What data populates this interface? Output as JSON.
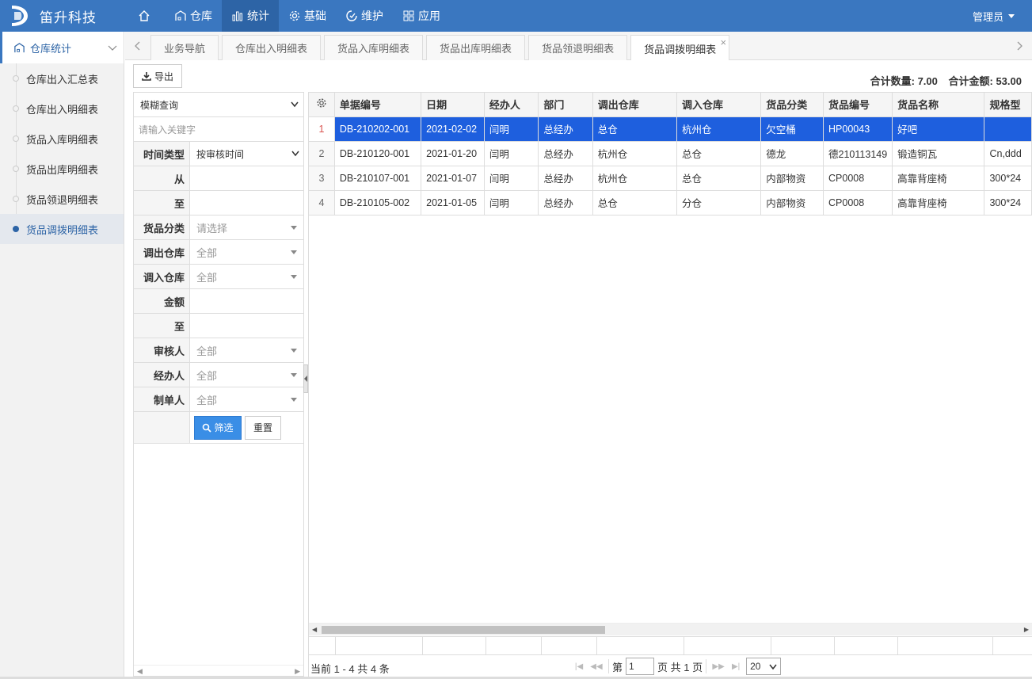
{
  "header": {
    "brand": "笛升科技",
    "nav": [
      {
        "key": "home",
        "label": "",
        "icon": "home-icon"
      },
      {
        "key": "warehouse",
        "label": "仓库",
        "icon": "warehouse-icon"
      },
      {
        "key": "stats",
        "label": "统计",
        "icon": "bar-chart-icon",
        "active": true
      },
      {
        "key": "basic",
        "label": "基础",
        "icon": "gear-icon"
      },
      {
        "key": "maintain",
        "label": "维护",
        "icon": "maintain-icon"
      },
      {
        "key": "apps",
        "label": "应用",
        "icon": "apps-icon"
      }
    ],
    "user": "管理员"
  },
  "sidebar": {
    "group": "仓库统计",
    "items": [
      {
        "label": "仓库出入汇总表"
      },
      {
        "label": "仓库出入明细表"
      },
      {
        "label": "货品入库明细表"
      },
      {
        "label": "货品出库明细表"
      },
      {
        "label": "货品领退明细表"
      },
      {
        "label": "货品调拨明细表",
        "active": true
      }
    ]
  },
  "tabs": [
    {
      "label": "业务导航"
    },
    {
      "label": "仓库出入明细表"
    },
    {
      "label": "货品入库明细表"
    },
    {
      "label": "货品出库明细表"
    },
    {
      "label": "货品领退明细表"
    },
    {
      "label": "货品调拨明细表",
      "active": true,
      "close": "×"
    }
  ],
  "toolbar": {
    "export_label": "导出",
    "total_qty": "合计数量: 7.00",
    "total_amount": "合计金额: 53.00"
  },
  "filter": {
    "fuzzy_mode": "模糊查询",
    "keyword_placeholder": "请输入关键字",
    "rows": [
      {
        "label": "时间类型",
        "value": "按审核时间",
        "kind": "select"
      },
      {
        "label": "从",
        "value": "",
        "kind": "input"
      },
      {
        "label": "至",
        "value": "",
        "kind": "input"
      },
      {
        "label": "货品分类",
        "value": "请选择",
        "kind": "combo"
      },
      {
        "label": "调出仓库",
        "value": "全部",
        "kind": "combo"
      },
      {
        "label": "调入仓库",
        "value": "全部",
        "kind": "combo"
      },
      {
        "label": "金额",
        "value": "",
        "kind": "input"
      },
      {
        "label": "至",
        "value": "",
        "kind": "input"
      },
      {
        "label": "审核人",
        "value": "全部",
        "kind": "combo"
      },
      {
        "label": "经办人",
        "value": "全部",
        "kind": "combo"
      },
      {
        "label": "制单人",
        "value": "全部",
        "kind": "combo"
      }
    ],
    "filter_label": "筛选",
    "reset_label": "重置"
  },
  "grid": {
    "columns": [
      "单据编号",
      "日期",
      "经办人",
      "部门",
      "调出仓库",
      "调入仓库",
      "货品分类",
      "货品编号",
      "货品名称",
      "规格型"
    ],
    "rows": [
      {
        "n": "1",
        "cells": [
          "DB-210202-001",
          "2021-02-02",
          "闫明",
          "总经办",
          "总仓",
          "杭州仓",
          "欠空桶",
          "HP00043",
          "好吧",
          ""
        ],
        "selected": true
      },
      {
        "n": "2",
        "cells": [
          "DB-210120-001",
          "2021-01-20",
          "闫明",
          "总经办",
          "杭州仓",
          "总仓",
          "德龙",
          "德210113149",
          "锻造铜瓦",
          "Cn,ddd"
        ]
      },
      {
        "n": "3",
        "cells": [
          "DB-210107-001",
          "2021-01-07",
          "闫明",
          "总经办",
          "杭州仓",
          "总仓",
          "内部物资",
          "CP0008",
          "高靠背座椅",
          "300*24"
        ]
      },
      {
        "n": "4",
        "cells": [
          "DB-210105-002",
          "2021-01-05",
          "闫明",
          "总经办",
          "总仓",
          "分仓",
          "内部物资",
          "CP0008",
          "高靠背座椅",
          "300*24"
        ]
      }
    ]
  },
  "pager": {
    "info": "当前 1 - 4 共 4 条",
    "page_prefix": "第",
    "page": "1",
    "page_suffix": "页 共 1 页",
    "page_size": "20"
  }
}
